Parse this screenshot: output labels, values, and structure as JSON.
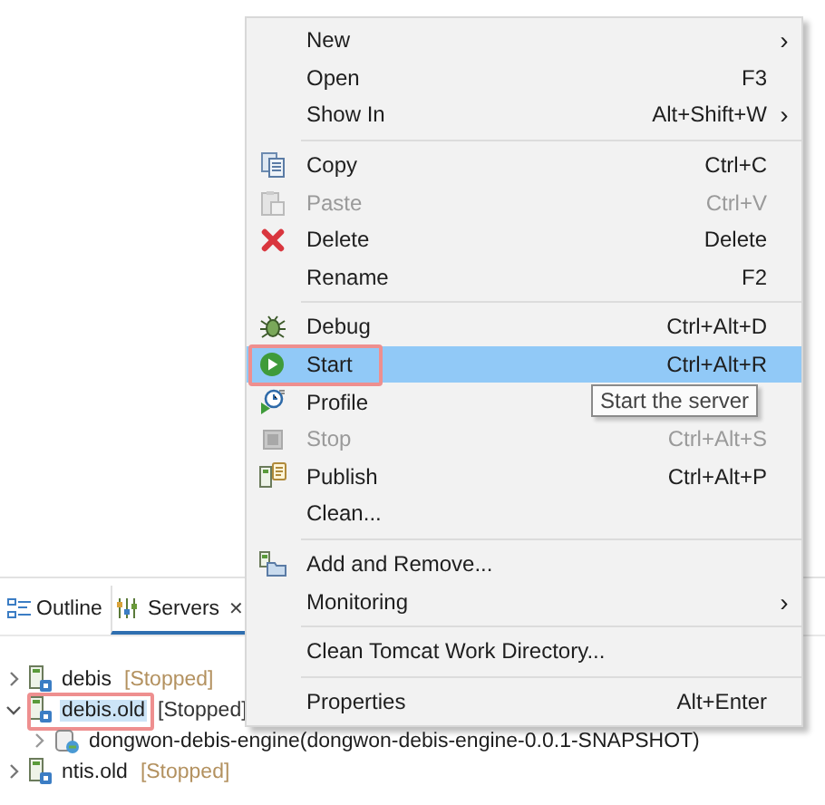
{
  "menu": [
    {
      "kind": "item",
      "label": "New",
      "arrow": "›",
      "disabled": false,
      "selected": false,
      "annotated": false
    },
    {
      "kind": "item",
      "label": "Open",
      "shortcut": "F3",
      "disabled": false,
      "selected": false,
      "annotated": false
    },
    {
      "kind": "item",
      "label": "Show In",
      "shortcut": "Alt+Shift+W",
      "arrow": "›",
      "disabled": false,
      "selected": false,
      "annotated": false
    },
    {
      "kind": "separator"
    },
    {
      "kind": "item",
      "label": "Copy",
      "shortcut": "Ctrl+C",
      "disabled": false,
      "selected": false,
      "annotated": false
    },
    {
      "kind": "item",
      "label": "Paste",
      "shortcut": "Ctrl+V",
      "disabled": true,
      "selected": false,
      "annotated": false
    },
    {
      "kind": "item",
      "label": "Delete",
      "shortcut": "Delete",
      "disabled": false,
      "selected": false,
      "annotated": false
    },
    {
      "kind": "item",
      "label": "Rename",
      "shortcut": "F2",
      "disabled": false,
      "selected": false,
      "annotated": false
    },
    {
      "kind": "separator"
    },
    {
      "kind": "item",
      "label": "Debug",
      "shortcut": "Ctrl+Alt+D",
      "disabled": false,
      "selected": false,
      "annotated": false
    },
    {
      "kind": "item",
      "label": "Start",
      "shortcut": "Ctrl+Alt+R",
      "disabled": false,
      "selected": true,
      "annotated": true
    },
    {
      "kind": "item",
      "label": "Profile",
      "disabled": false,
      "selected": false,
      "annotated": false
    },
    {
      "kind": "item",
      "label": "Stop",
      "shortcut": "Ctrl+Alt+S",
      "disabled": true,
      "selected": false,
      "annotated": false
    },
    {
      "kind": "item",
      "label": "Publish",
      "shortcut": "Ctrl+Alt+P",
      "disabled": false,
      "selected": false,
      "annotated": false
    },
    {
      "kind": "item",
      "label": "Clean...",
      "disabled": false,
      "selected": false,
      "annotated": false
    },
    {
      "kind": "separator"
    },
    {
      "kind": "item",
      "label": "Add and Remove...",
      "disabled": false,
      "selected": false,
      "annotated": false
    },
    {
      "kind": "item",
      "label": "Monitoring",
      "arrow": "›",
      "disabled": false,
      "selected": false,
      "annotated": false
    },
    {
      "kind": "separator"
    },
    {
      "kind": "item",
      "label": "Clean Tomcat Work Directory...",
      "disabled": false,
      "selected": false,
      "annotated": false
    },
    {
      "kind": "separator"
    },
    {
      "kind": "item",
      "label": "Properties",
      "shortcut": "Alt+Enter",
      "disabled": false,
      "selected": false,
      "annotated": false
    }
  ],
  "tooltip": "Start the server",
  "tabs": [
    {
      "label": "Outline",
      "selected": false
    },
    {
      "label": "Servers",
      "selected": true,
      "close": "✕"
    }
  ],
  "servers": [
    {
      "label": "debis",
      "status": "[Stopped]",
      "expanded": false,
      "selected": false,
      "annotated": false
    },
    {
      "label": "debis.old",
      "status": "[Stopped]",
      "expanded": true,
      "selected": true,
      "annotated": true,
      "children": [
        {
          "label": "dongwon-debis-engine(dongwon-debis-engine-0.0.1-SNAPSHOT)",
          "expanded": false
        }
      ]
    },
    {
      "label": "ntis.old",
      "status": "[Stopped]",
      "expanded": false,
      "selected": false,
      "annotated": false
    }
  ]
}
